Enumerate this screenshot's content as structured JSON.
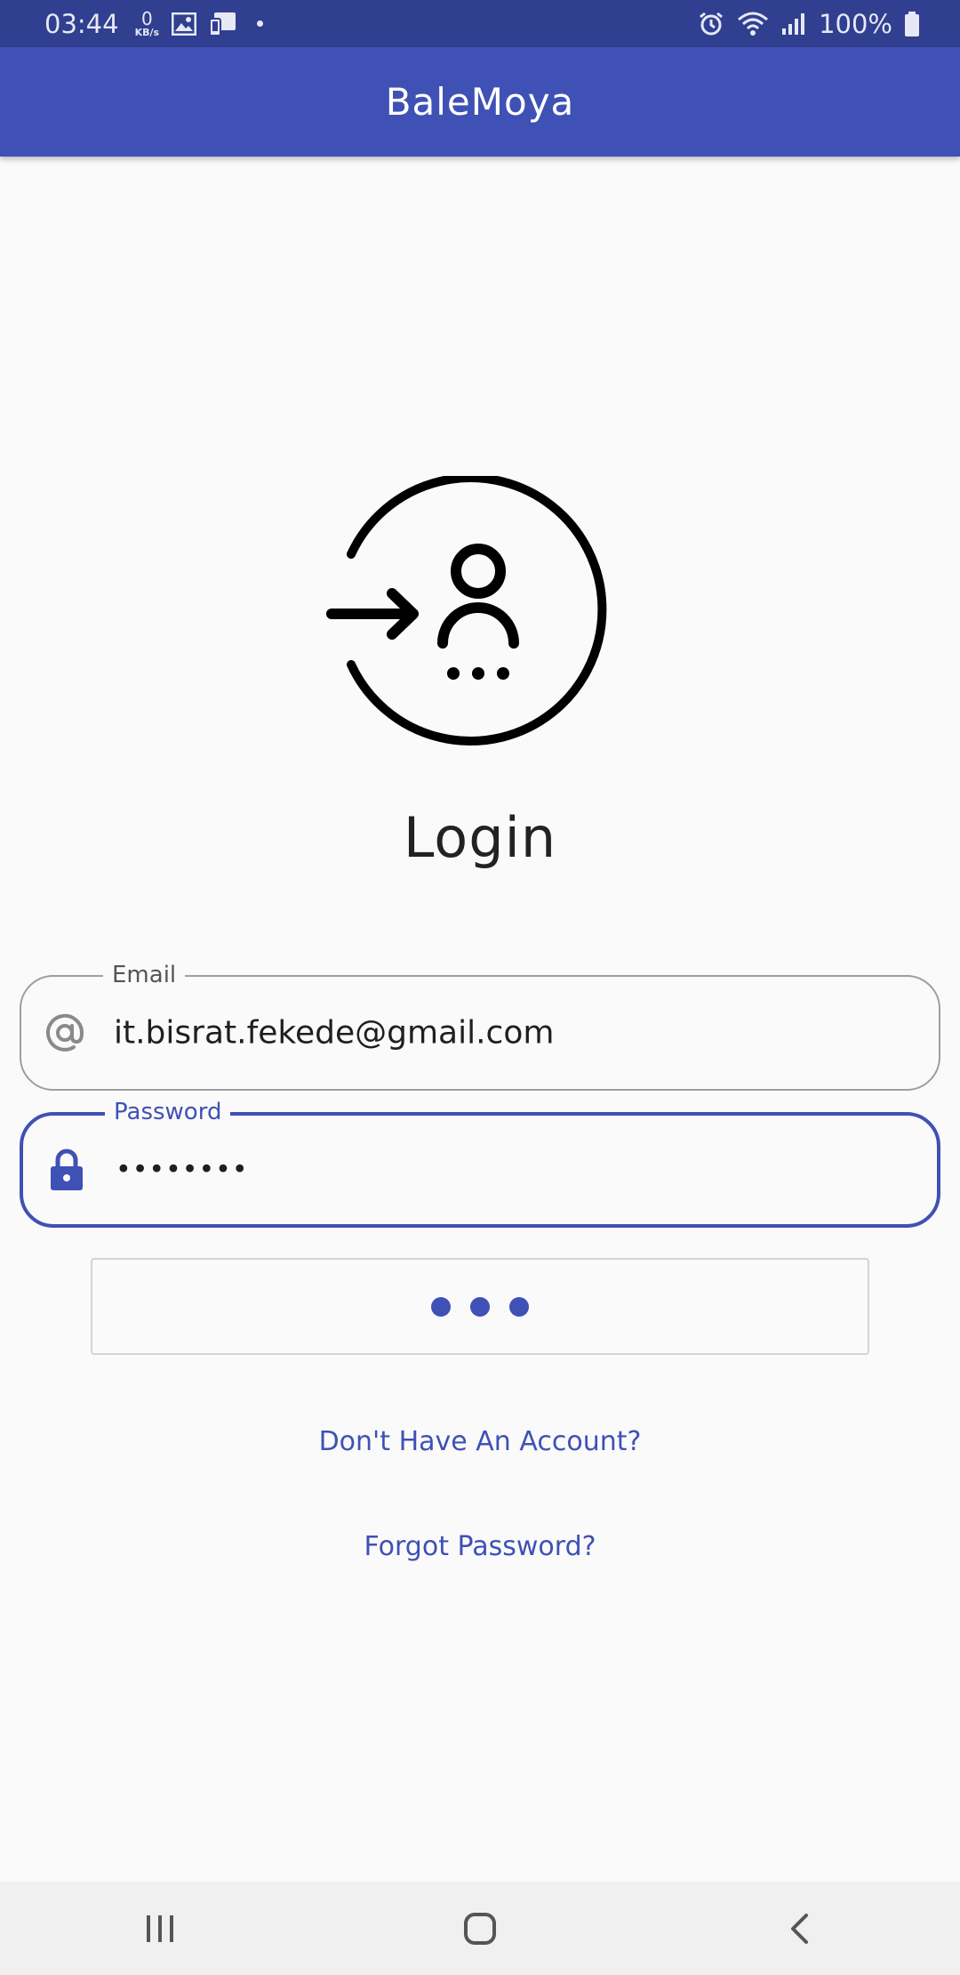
{
  "status_bar": {
    "time": "03:44",
    "net_speed": "0",
    "net_unit": "KB/s",
    "battery": "100%",
    "background": "#303f8f",
    "icons": [
      "image-icon",
      "device-icon",
      "notification-dot-icon",
      "alarm-icon",
      "wifi-icon",
      "signal-icon",
      "battery-icon"
    ]
  },
  "app_bar": {
    "title": "BaleMoya",
    "color": "#3f51b5"
  },
  "login": {
    "illustration_icon": "login-user-icon",
    "title": "Login"
  },
  "form": {
    "email": {
      "label": "Email",
      "value": "it.bisrat.fekede@gmail.com",
      "icon": "at-icon"
    },
    "password": {
      "label": "Password",
      "value": "••••••••",
      "icon": "lock-icon"
    },
    "submit": {
      "state": "loading",
      "indicator_icon": "loading-dots-icon"
    }
  },
  "links": {
    "signup": "Don't Have An Account?",
    "forgot": "Forgot Password?"
  },
  "nav_bar": {
    "buttons": [
      "recent-apps-icon",
      "home-icon",
      "back-icon"
    ]
  }
}
